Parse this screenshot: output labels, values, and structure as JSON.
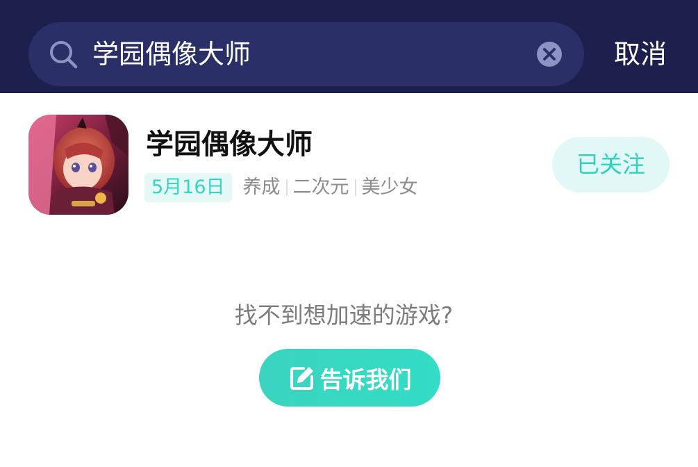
{
  "search": {
    "query": "学园偶像大师",
    "cancel_label": "取消",
    "search_icon": "search-icon",
    "clear_icon": "clear-icon"
  },
  "result": {
    "title": "学园偶像大师",
    "date_badge": "5月16日",
    "tags": [
      "养成",
      "二次元",
      "美少女"
    ],
    "follow_label": "已关注"
  },
  "empty_hint": {
    "text": "找不到想加速的游戏?",
    "button_label": "告诉我们",
    "button_icon": "edit-icon"
  },
  "colors": {
    "topbar_bg": "#1d1f4d",
    "search_bg": "#2a2f68",
    "accent": "#35d3c1",
    "follow_bg": "#e2f8f6"
  }
}
